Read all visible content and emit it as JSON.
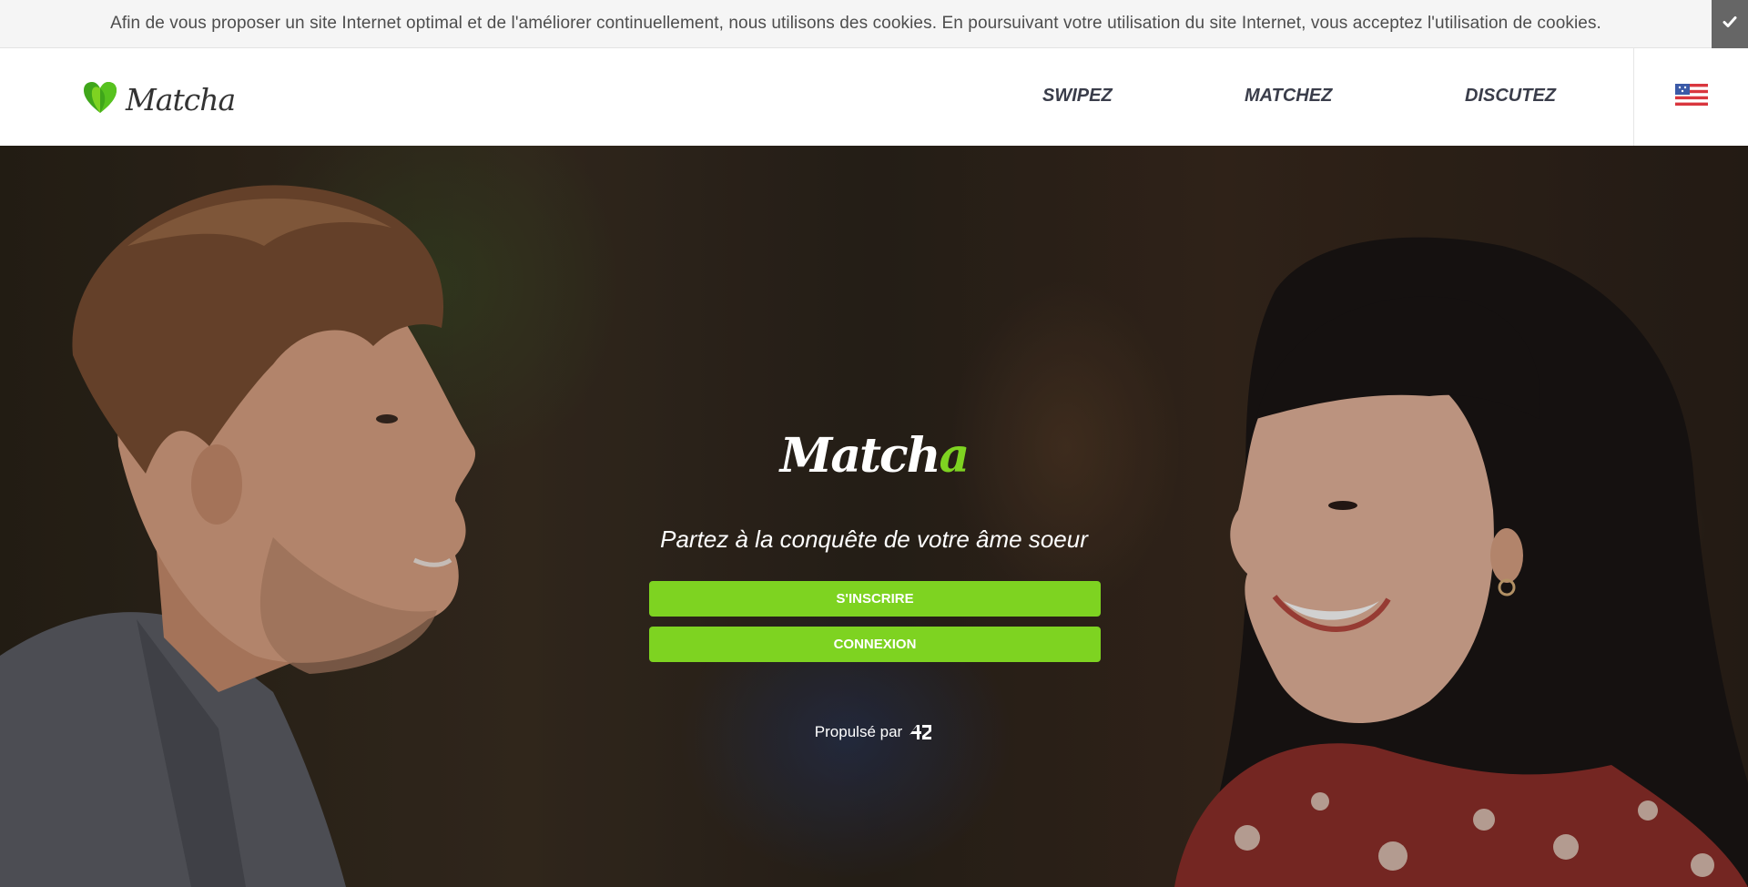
{
  "cookie_banner": {
    "text": "Afin de vous proposer un site Internet optimal et de l'améliorer continuellement, nous utilisons des cookies. En poursuivant votre utilisation du site Internet, vous acceptez l'utilisation de cookies.",
    "accept_icon": "checkmark-icon"
  },
  "header": {
    "logo_text": "Matcha",
    "logo_icon": "green-heart-icon",
    "nav": [
      {
        "label": "SWIPEZ"
      },
      {
        "label": "MATCHEZ"
      },
      {
        "label": "DISCUTEZ"
      }
    ],
    "language_icon": "us-flag-icon"
  },
  "hero": {
    "logo_main": "Match",
    "logo_accent": "a",
    "tagline": "Partez à la conquête de votre âme soeur",
    "signup_label": "S'INSCRIRE",
    "login_label": "CONNEXION",
    "powered_by": "Propulsé par",
    "powered_logo": "42"
  },
  "colors": {
    "accent": "#7ed321",
    "nav_text": "#3a3d4a",
    "cookie_bg": "#f5f5f5",
    "cookie_button": "#666666"
  }
}
